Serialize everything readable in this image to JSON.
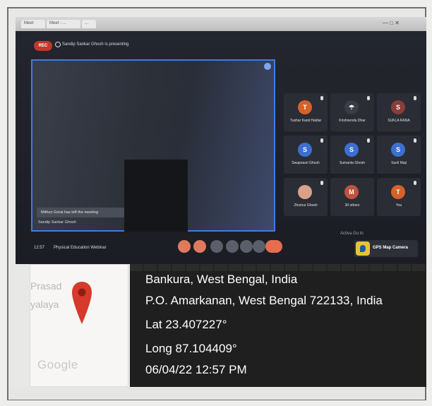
{
  "browser": {
    "tabs": [
      "Meet",
      "Meet - ...",
      "..."
    ],
    "window_controls": "— □ ✕"
  },
  "meet": {
    "rec_label": "REC",
    "presenting_text": "Sandip Sankar Ghosh is presenting",
    "left_notice": "Mithun Gorai has left the meeting",
    "presenter_label": "Sandip Sankar Ghosh",
    "meeting_time": "12:57",
    "meeting_title": "Physical Education Webinar",
    "activate_text": "Activa Go to",
    "participants": [
      {
        "initial": "T",
        "name": "Tushar Kanti Haldar",
        "color": "#d4622a"
      },
      {
        "initial": "☂",
        "name": "Krishnendu Dhar",
        "color": "#3a3d45"
      },
      {
        "initial": "S",
        "name": "SUKLA RANA",
        "color": "#8a3b3b"
      },
      {
        "initial": "S",
        "name": "Swapnasri Ghosh",
        "color": "#3d6fd1"
      },
      {
        "initial": "S",
        "name": "Sumanta Ghosh",
        "color": "#3d6fd1"
      },
      {
        "initial": "S",
        "name": "Sunil Maji",
        "color": "#3d6fd1"
      },
      {
        "initial": "",
        "name": "Zhumur Ghosh",
        "color": "#d9a08a"
      },
      {
        "initial": "M",
        "name": "30 others",
        "color": "#c0533a"
      },
      {
        "initial": "T",
        "name": "You",
        "color": "#d4622a"
      }
    ]
  },
  "gps_app": {
    "name": "GPS Map Camera"
  },
  "map": {
    "label_top": "Prasad",
    "label_bottom": "yalaya",
    "logo_text": "Google"
  },
  "location": {
    "place": "Bankura, West Bengal, India",
    "address": "P.O. Amarkanan, West Bengal 722133, India",
    "lat": "Lat 23.407227°",
    "long": "Long 87.104409°",
    "datetime": "06/04/22 12:57 PM"
  },
  "colors": {
    "accent_border": "#3f7be8",
    "record_red": "#c0392b",
    "pin_red": "#d63a2b",
    "info_bg": "#1f1f1f"
  }
}
